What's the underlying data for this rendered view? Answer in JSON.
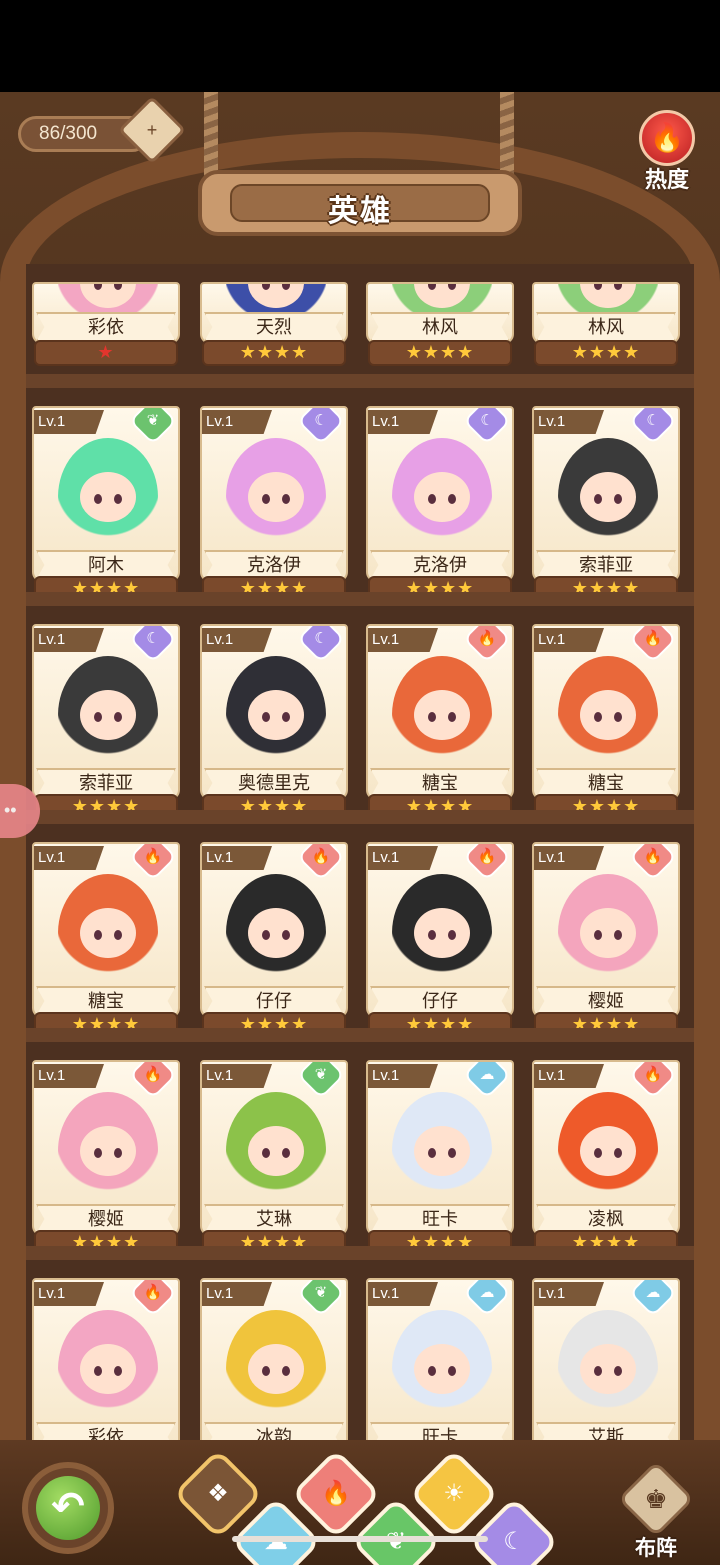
{
  "header": {
    "capacity": "86/300",
    "capacity_icon": "chest-plus-icon",
    "title": "英雄",
    "heat_label": "热度",
    "heat_icon": "flame-icon"
  },
  "colors": {
    "fire": "#f08a86",
    "moon": "#a48be6",
    "leaf": "#6cc36e",
    "water": "#7fcbe6",
    "star": "#ffc93a",
    "star_red": "#e3352d"
  },
  "heroes": [
    {
      "name": "彩依",
      "level": "",
      "element": "",
      "stars": "★",
      "star_color": "red",
      "hair": "#f3a6c3"
    },
    {
      "name": "天烈",
      "level": "",
      "element": "",
      "stars": "★★★★",
      "star_color": "gold",
      "hair": "#3d4fa8"
    },
    {
      "name": "林风",
      "level": "",
      "element": "",
      "stars": "★★★★",
      "star_color": "gold",
      "hair": "#8ccf7a"
    },
    {
      "name": "林风",
      "level": "",
      "element": "",
      "stars": "★★★★",
      "star_color": "gold",
      "hair": "#8ccf7a"
    },
    {
      "name": "阿木",
      "level": "Lv.1",
      "element": "leaf",
      "stars": "★★★★",
      "star_color": "gold",
      "hair": "#5fe0a8"
    },
    {
      "name": "克洛伊",
      "level": "Lv.1",
      "element": "moon",
      "stars": "★★★★",
      "star_color": "gold",
      "hair": "#e7a0e6"
    },
    {
      "name": "克洛伊",
      "level": "Lv.1",
      "element": "moon",
      "stars": "★★★★",
      "star_color": "gold",
      "hair": "#e7a0e6"
    },
    {
      "name": "索菲亚",
      "level": "Lv.1",
      "element": "moon",
      "stars": "★★★★",
      "star_color": "gold",
      "hair": "#3a3a3a"
    },
    {
      "name": "索菲亚",
      "level": "Lv.1",
      "element": "moon",
      "stars": "★★★★",
      "star_color": "gold",
      "hair": "#3a3a3a"
    },
    {
      "name": "奥德里克",
      "level": "Lv.1",
      "element": "moon",
      "stars": "★★★★",
      "star_color": "gold",
      "hair": "#2f2f36"
    },
    {
      "name": "糖宝",
      "level": "Lv.1",
      "element": "fire",
      "stars": "★★★★",
      "star_color": "gold",
      "hair": "#e9683a"
    },
    {
      "name": "糖宝",
      "level": "Lv.1",
      "element": "fire",
      "stars": "★★★★",
      "star_color": "gold",
      "hair": "#e9683a"
    },
    {
      "name": "糖宝",
      "level": "Lv.1",
      "element": "fire",
      "stars": "★★★★",
      "star_color": "gold",
      "hair": "#e9683a"
    },
    {
      "name": "仔仔",
      "level": "Lv.1",
      "element": "fire",
      "stars": "★★★★",
      "star_color": "gold",
      "hair": "#2a2a2a"
    },
    {
      "name": "仔仔",
      "level": "Lv.1",
      "element": "fire",
      "stars": "★★★★",
      "star_color": "gold",
      "hair": "#2a2a2a"
    },
    {
      "name": "樱姬",
      "level": "Lv.1",
      "element": "fire",
      "stars": "★★★★",
      "star_color": "gold",
      "hair": "#f4a5bd"
    },
    {
      "name": "樱姬",
      "level": "Lv.1",
      "element": "fire",
      "stars": "★★★★",
      "star_color": "gold",
      "hair": "#f4a5bd"
    },
    {
      "name": "艾琳",
      "level": "Lv.1",
      "element": "leaf",
      "stars": "★★★★",
      "star_color": "gold",
      "hair": "#8cc24a"
    },
    {
      "name": "旺卡",
      "level": "Lv.1",
      "element": "water",
      "stars": "★★★★",
      "star_color": "gold",
      "hair": "#dfe8f6"
    },
    {
      "name": "凌枫",
      "level": "Lv.1",
      "element": "fire",
      "stars": "★★★★",
      "star_color": "gold",
      "hair": "#ee5a2a"
    },
    {
      "name": "彩依",
      "level": "Lv.1",
      "element": "fire",
      "stars": "",
      "star_color": "gold",
      "hair": "#f3a6c3"
    },
    {
      "name": "冰韵",
      "level": "Lv.1",
      "element": "leaf",
      "stars": "",
      "star_color": "gold",
      "hair": "#f0c43c"
    },
    {
      "name": "旺卡",
      "level": "Lv.1",
      "element": "water",
      "stars": "",
      "star_color": "gold",
      "hair": "#dfe8f6"
    },
    {
      "name": "艾斯",
      "level": "Lv.1",
      "element": "water",
      "stars": "",
      "star_color": "gold",
      "hair": "#e6e6e6"
    }
  ],
  "element_icons": {
    "fire": "🔥",
    "moon": "☾",
    "leaf": "❦",
    "water": "☁"
  },
  "footer": {
    "back_icon": "back-arrow-icon",
    "filters": [
      {
        "id": "all",
        "icon": "grid-icon",
        "glyph": "❖"
      },
      {
        "id": "water",
        "icon": "cloud-icon",
        "glyph": "☁"
      },
      {
        "id": "fire",
        "icon": "flame-icon",
        "glyph": "🔥"
      },
      {
        "id": "leaf",
        "icon": "leaf-icon",
        "glyph": "❦"
      },
      {
        "id": "light",
        "icon": "sun-icon",
        "glyph": "☀"
      },
      {
        "id": "moon",
        "icon": "moon-icon",
        "glyph": "☾"
      }
    ],
    "formation_label": "布阵",
    "formation_icon": "chess-icon"
  }
}
